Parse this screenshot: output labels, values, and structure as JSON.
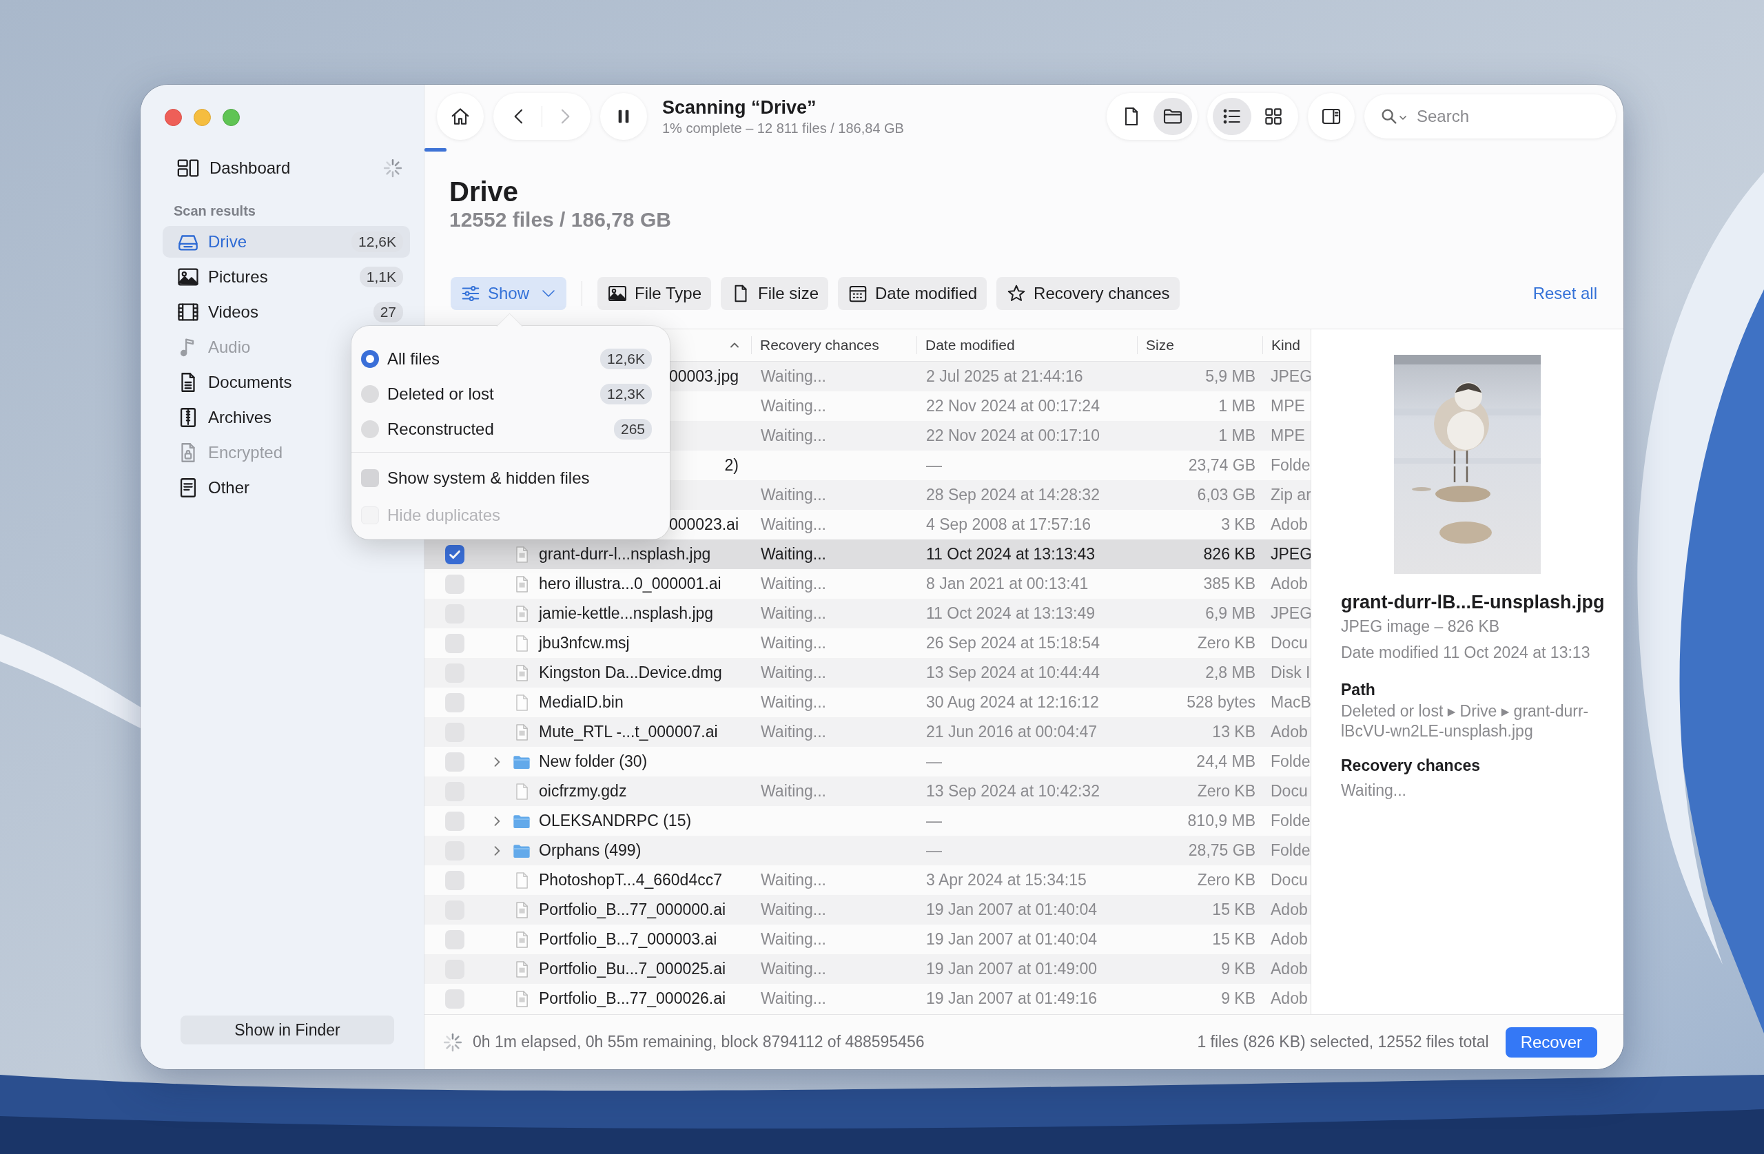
{
  "sidebar": {
    "dashboard": {
      "label": "Dashboard",
      "busy": true
    },
    "section_title": "Scan results",
    "items": [
      {
        "kind": "drive",
        "label": "Drive",
        "count": "12,6K",
        "selected": true,
        "disabled": false
      },
      {
        "kind": "pictures",
        "label": "Pictures",
        "count": "1,1K",
        "selected": false,
        "disabled": false
      },
      {
        "kind": "videos",
        "label": "Videos",
        "count": "27",
        "selected": false,
        "disabled": false
      },
      {
        "kind": "audio",
        "label": "Audio",
        "selected": false,
        "disabled": true
      },
      {
        "kind": "documents",
        "label": "Documents",
        "selected": false,
        "disabled": false
      },
      {
        "kind": "archives",
        "label": "Archives",
        "selected": false,
        "disabled": false
      },
      {
        "kind": "encrypted",
        "label": "Encrypted",
        "selected": false,
        "disabled": true
      },
      {
        "kind": "other",
        "label": "Other",
        "selected": false,
        "disabled": false
      }
    ],
    "footer_button": "Show in Finder"
  },
  "toolbar": {
    "navigation": {
      "back_disabled": false,
      "forward_disabled": true
    },
    "title": "Scanning “Drive”",
    "subtitle": "1% complete – 12 811 files / 186,84 GB",
    "view_modes": [
      {
        "kind": "files",
        "selected": false
      },
      {
        "kind": "folders",
        "selected": true
      }
    ],
    "layouts": [
      {
        "kind": "list",
        "selected": true
      },
      {
        "kind": "grid",
        "selected": false
      }
    ],
    "search": {
      "placeholder": "Search"
    }
  },
  "heading": {
    "title": "Drive",
    "subtitle": "12552 files / 186,78 GB"
  },
  "filters": {
    "show": {
      "label": "Show",
      "expanded": true
    },
    "chips": [
      {
        "kind": "file_type",
        "label": "File Type"
      },
      {
        "kind": "file_size",
        "label": "File size"
      },
      {
        "kind": "date_modified",
        "label": "Date modified"
      },
      {
        "kind": "recovery_chances",
        "label": "Recovery chances"
      }
    ],
    "reset": "Reset all"
  },
  "popover": {
    "options": [
      {
        "label": "All files",
        "count": "12,6K",
        "selected": true
      },
      {
        "label": "Deleted or lost",
        "count": "12,3K",
        "selected": false
      },
      {
        "label": "Reconstructed",
        "count": "265",
        "selected": false
      }
    ],
    "checkboxes": [
      {
        "label": "Show system & hidden files",
        "checked": false,
        "disabled": false
      },
      {
        "label": "Hide duplicates",
        "checked": false,
        "disabled": true
      }
    ]
  },
  "table": {
    "columns": [
      "Recovery chances",
      "Date modified",
      "Size",
      "Kind"
    ],
    "rows": [
      {
        "kind": "covered",
        "name": "00003.jpg",
        "recovery": "Waiting...",
        "date": "2 Jul 2025 at 21:44:16",
        "size": "5,9 MB",
        "kind_label": "JPEG",
        "selected": false
      },
      {
        "kind": "covered",
        "recovery": "Waiting...",
        "date": "22 Nov 2024 at 00:17:24",
        "size": "1 MB",
        "kind_label": "MPE",
        "selected": false
      },
      {
        "kind": "covered",
        "recovery": "Waiting...",
        "date": "22 Nov 2024 at 00:17:10",
        "size": "1 MB",
        "kind_label": "MPE",
        "selected": false
      },
      {
        "kind": "covered",
        "name": "2)",
        "date": "—",
        "size": "23,74 GB",
        "kind_label": "Folde",
        "selected": false
      },
      {
        "kind": "covered",
        "recovery": "Waiting...",
        "date": "28 Sep 2024 at 14:28:32",
        "size": "6,03 GB",
        "kind_label": "Zip ar",
        "selected": false
      },
      {
        "kind": "covered",
        "name": "000023.ai",
        "recovery": "Waiting...",
        "date": "4 Sep 2008 at 17:57:16",
        "size": "3 KB",
        "kind_label": "Adob",
        "selected": false
      },
      {
        "kind": "file",
        "checked": true,
        "name": "grant-durr-l...nsplash.jpg",
        "recovery": "Waiting...",
        "date": "11 Oct 2024 at 13:13:43",
        "size": "826 KB",
        "kind_label": "JPEG",
        "selected": true
      },
      {
        "kind": "file",
        "checked": false,
        "name": "hero illustra...0_000001.ai",
        "recovery": "Waiting...",
        "date": "8 Jan 2021 at 00:13:41",
        "size": "385 KB",
        "kind_label": "Adob",
        "selected": false
      },
      {
        "kind": "file",
        "checked": false,
        "name": "jamie-kettle...nsplash.jpg",
        "recovery": "Waiting...",
        "date": "11 Oct 2024 at 13:13:49",
        "size": "6,9 MB",
        "kind_label": "JPEG",
        "selected": false
      },
      {
        "kind": "blank",
        "checked": false,
        "name": "jbu3nfcw.msj",
        "recovery": "Waiting...",
        "date": "26 Sep 2024 at 15:18:54",
        "size": "Zero KB",
        "kind_label": "Docu",
        "selected": false
      },
      {
        "kind": "file",
        "checked": false,
        "name": "Kingston Da...Device.dmg",
        "recovery": "Waiting...",
        "date": "13 Sep 2024 at 10:44:44",
        "size": "2,8 MB",
        "kind_label": "Disk I",
        "selected": false
      },
      {
        "kind": "blank",
        "checked": false,
        "name": "MediaID.bin",
        "recovery": "Waiting...",
        "date": "30 Aug 2024 at 12:16:12",
        "size": "528 bytes",
        "kind_label": "MacB",
        "selected": false
      },
      {
        "kind": "file",
        "checked": false,
        "name": "Mute_RTL -...t_000007.ai",
        "recovery": "Waiting...",
        "date": "21 Jun 2016 at 00:04:47",
        "size": "13 KB",
        "kind_label": "Adob",
        "selected": false
      },
      {
        "kind": "folder",
        "checked": false,
        "name": "New folder (30)",
        "date": "—",
        "size": "24,4 MB",
        "kind_label": "Folde",
        "selected": false
      },
      {
        "kind": "blank",
        "checked": false,
        "name": "oicfrzmy.gdz",
        "recovery": "Waiting...",
        "date": "13 Sep 2024 at 10:42:32",
        "size": "Zero KB",
        "kind_label": "Docu",
        "selected": false
      },
      {
        "kind": "folder",
        "checked": false,
        "name": "OLEKSANDRPC (15)",
        "date": "—",
        "size": "810,9 MB",
        "kind_label": "Folde",
        "selected": false
      },
      {
        "kind": "folder",
        "checked": false,
        "name": "Orphans (499)",
        "date": "—",
        "size": "28,75 GB",
        "kind_label": "Folde",
        "selected": false
      },
      {
        "kind": "blank",
        "checked": false,
        "name": "PhotoshopT...4_660d4cc7",
        "recovery": "Waiting...",
        "date": "3 Apr 2024 at 15:34:15",
        "size": "Zero KB",
        "kind_label": "Docu",
        "selected": false
      },
      {
        "kind": "file",
        "checked": false,
        "name": "Portfolio_B...77_000000.ai",
        "recovery": "Waiting...",
        "date": "19 Jan 2007 at 01:40:04",
        "size": "15 KB",
        "kind_label": "Adob",
        "selected": false
      },
      {
        "kind": "file",
        "checked": false,
        "name": "Portfolio_B...7_000003.ai",
        "recovery": "Waiting...",
        "date": "19 Jan 2007 at 01:40:04",
        "size": "15 KB",
        "kind_label": "Adob",
        "selected": false
      },
      {
        "kind": "file",
        "checked": false,
        "name": "Portfolio_Bu...7_000025.ai",
        "recovery": "Waiting...",
        "date": "19 Jan 2007 at 01:49:00",
        "size": "9 KB",
        "kind_label": "Adob",
        "selected": false
      },
      {
        "kind": "file",
        "checked": false,
        "name": "Portfolio_B...77_000026.ai",
        "recovery": "Waiting...",
        "date": "19 Jan 2007 at 01:49:16",
        "size": "9 KB",
        "kind_label": "Adob",
        "selected": false
      }
    ]
  },
  "details": {
    "name": "grant-durr-lB...E-unsplash.jpg",
    "info": "JPEG image – 826 KB",
    "date": "Date modified 11 Oct 2024 at 13:13",
    "path_title": "Path",
    "path": "Deleted or lost ▸ Drive ▸ grant-durr-lBcVU-wn2LE-unsplash.jpg",
    "recovery_title": "Recovery chances",
    "recovery": "Waiting..."
  },
  "status_bar": {
    "busy": true,
    "text": "0h 1m elapsed, 0h 55m remaining, block 8794112 of 488595456",
    "selection": "1 files (826 KB) selected, 12552 files total",
    "button": "Recover"
  }
}
